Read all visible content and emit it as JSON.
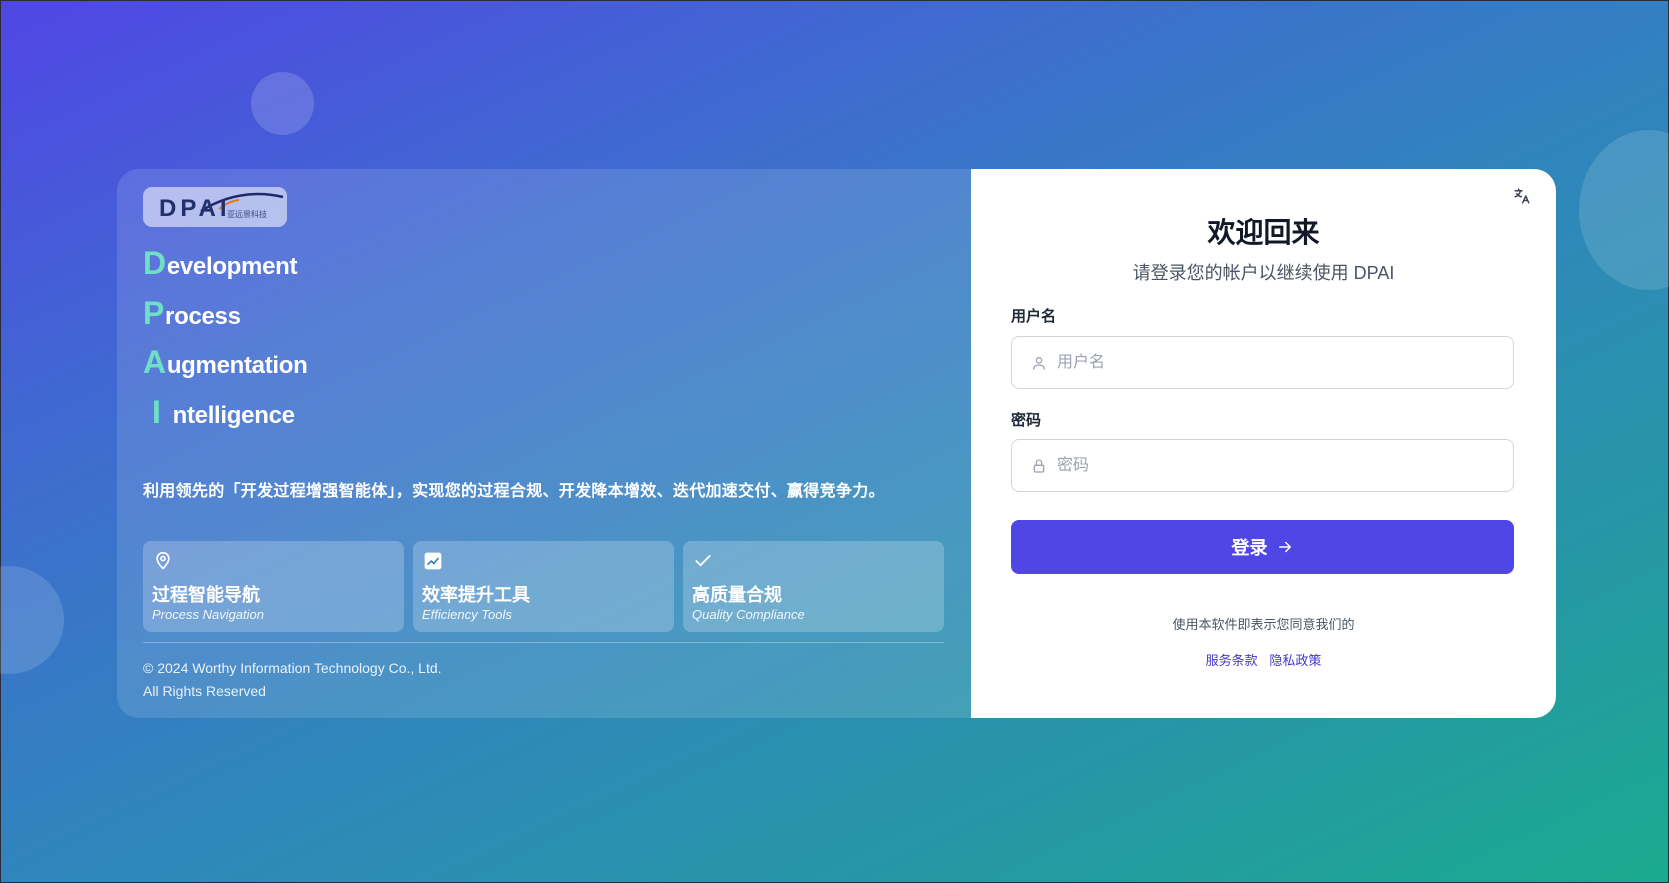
{
  "brand": {
    "logo_text": "DPAI",
    "logo_sub": "亚远景科技",
    "acronym": [
      {
        "cap": "D",
        "rest": "evelopment"
      },
      {
        "cap": "P",
        "rest": "rocess"
      },
      {
        "cap": "A",
        "rest": "ugmentation"
      },
      {
        "cap": "I",
        "rest": "ntelligence"
      }
    ],
    "tagline": "利用领先的「开发过程增强智能体」，实现您的过程合规、开发降本增效、迭代加速交付、赢得竞争力。"
  },
  "features": [
    {
      "icon": "map-pin-icon",
      "title": "过程智能导航",
      "subtitle": "Process Navigation"
    },
    {
      "icon": "chart-line-icon",
      "title": "效率提升工具",
      "subtitle": "Efficiency Tools"
    },
    {
      "icon": "check-icon",
      "title": "高质量合规",
      "subtitle": "Quality Compliance"
    }
  ],
  "footer": {
    "copyright": "© 2024 Worthy Information Technology Co., Ltd.",
    "rights": "All Rights Reserved"
  },
  "login": {
    "title": "欢迎回来",
    "subtitle": "请登录您的帐户以继续使用 DPAI",
    "username_label": "用户名",
    "username_placeholder": "用户名",
    "username_value": "",
    "password_label": "密码",
    "password_placeholder": "密码",
    "password_value": "",
    "submit_label": "登录",
    "agree_text": "使用本软件即表示您同意我们的",
    "terms_link": "服务条款",
    "privacy_link": "隐私政策"
  },
  "colors": {
    "primary": "#4f46e5",
    "accent_letter": "#6fe0c8",
    "link": "#4338ca"
  }
}
